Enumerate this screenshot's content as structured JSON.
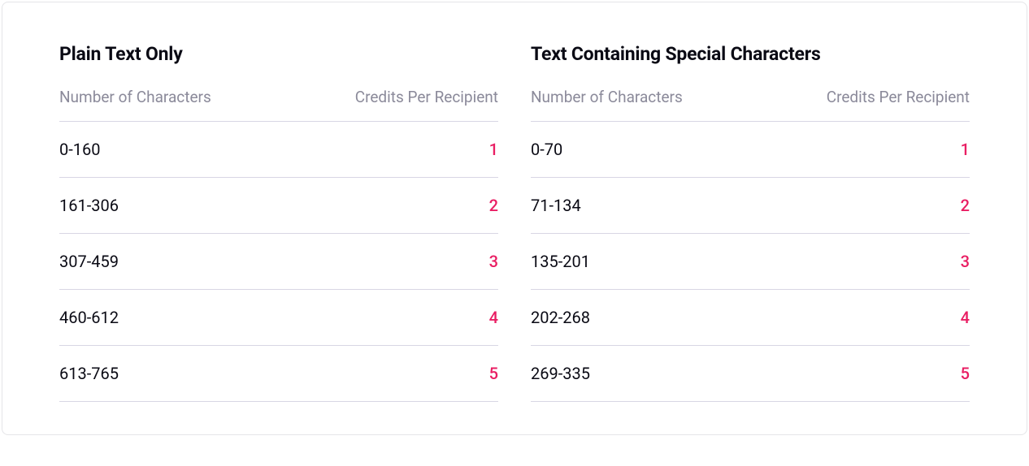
{
  "tables": [
    {
      "title": "Plain Text Only",
      "col1": "Number of Characters",
      "col2": "Credits Per Recipient",
      "rows": [
        {
          "range": "0-160",
          "credits": "1"
        },
        {
          "range": "161-306",
          "credits": "2"
        },
        {
          "range": "307-459",
          "credits": "3"
        },
        {
          "range": "460-612",
          "credits": "4"
        },
        {
          "range": "613-765",
          "credits": "5"
        }
      ]
    },
    {
      "title": "Text Containing Special Characters",
      "col1": "Number of Characters",
      "col2": "Credits Per Recipient",
      "rows": [
        {
          "range": "0-70",
          "credits": "1"
        },
        {
          "range": "71-134",
          "credits": "2"
        },
        {
          "range": "135-201",
          "credits": "3"
        },
        {
          "range": "202-268",
          "credits": "4"
        },
        {
          "range": "269-335",
          "credits": "5"
        }
      ]
    }
  ]
}
